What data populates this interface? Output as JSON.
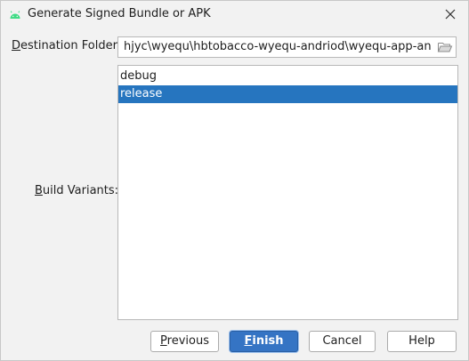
{
  "window": {
    "title": "Generate Signed Bundle or APK",
    "app_icon": "android-icon",
    "close_icon": "close-icon"
  },
  "destination": {
    "label_mnemonic": "D",
    "label_rest": "estination Folder:",
    "value": "hjyc\\wyequ\\hbtobacco-wyequ-andriod\\wyequ-app-android",
    "browse_icon": "folder-open-icon"
  },
  "build_variants": {
    "label_mnemonic": "B",
    "label_rest": "uild Variants:",
    "items": [
      {
        "label": "debug",
        "selected": false
      },
      {
        "label": "release",
        "selected": true
      }
    ]
  },
  "buttons": {
    "previous": {
      "mnemonic": "P",
      "rest": "revious"
    },
    "finish": {
      "mnemonic": "F",
      "rest": "inish"
    },
    "cancel": {
      "label": "Cancel"
    },
    "help": {
      "label": "Help"
    }
  },
  "colors": {
    "selection": "#2675bf",
    "primary_button": "#3574c4",
    "android_green": "#3ddc84"
  }
}
